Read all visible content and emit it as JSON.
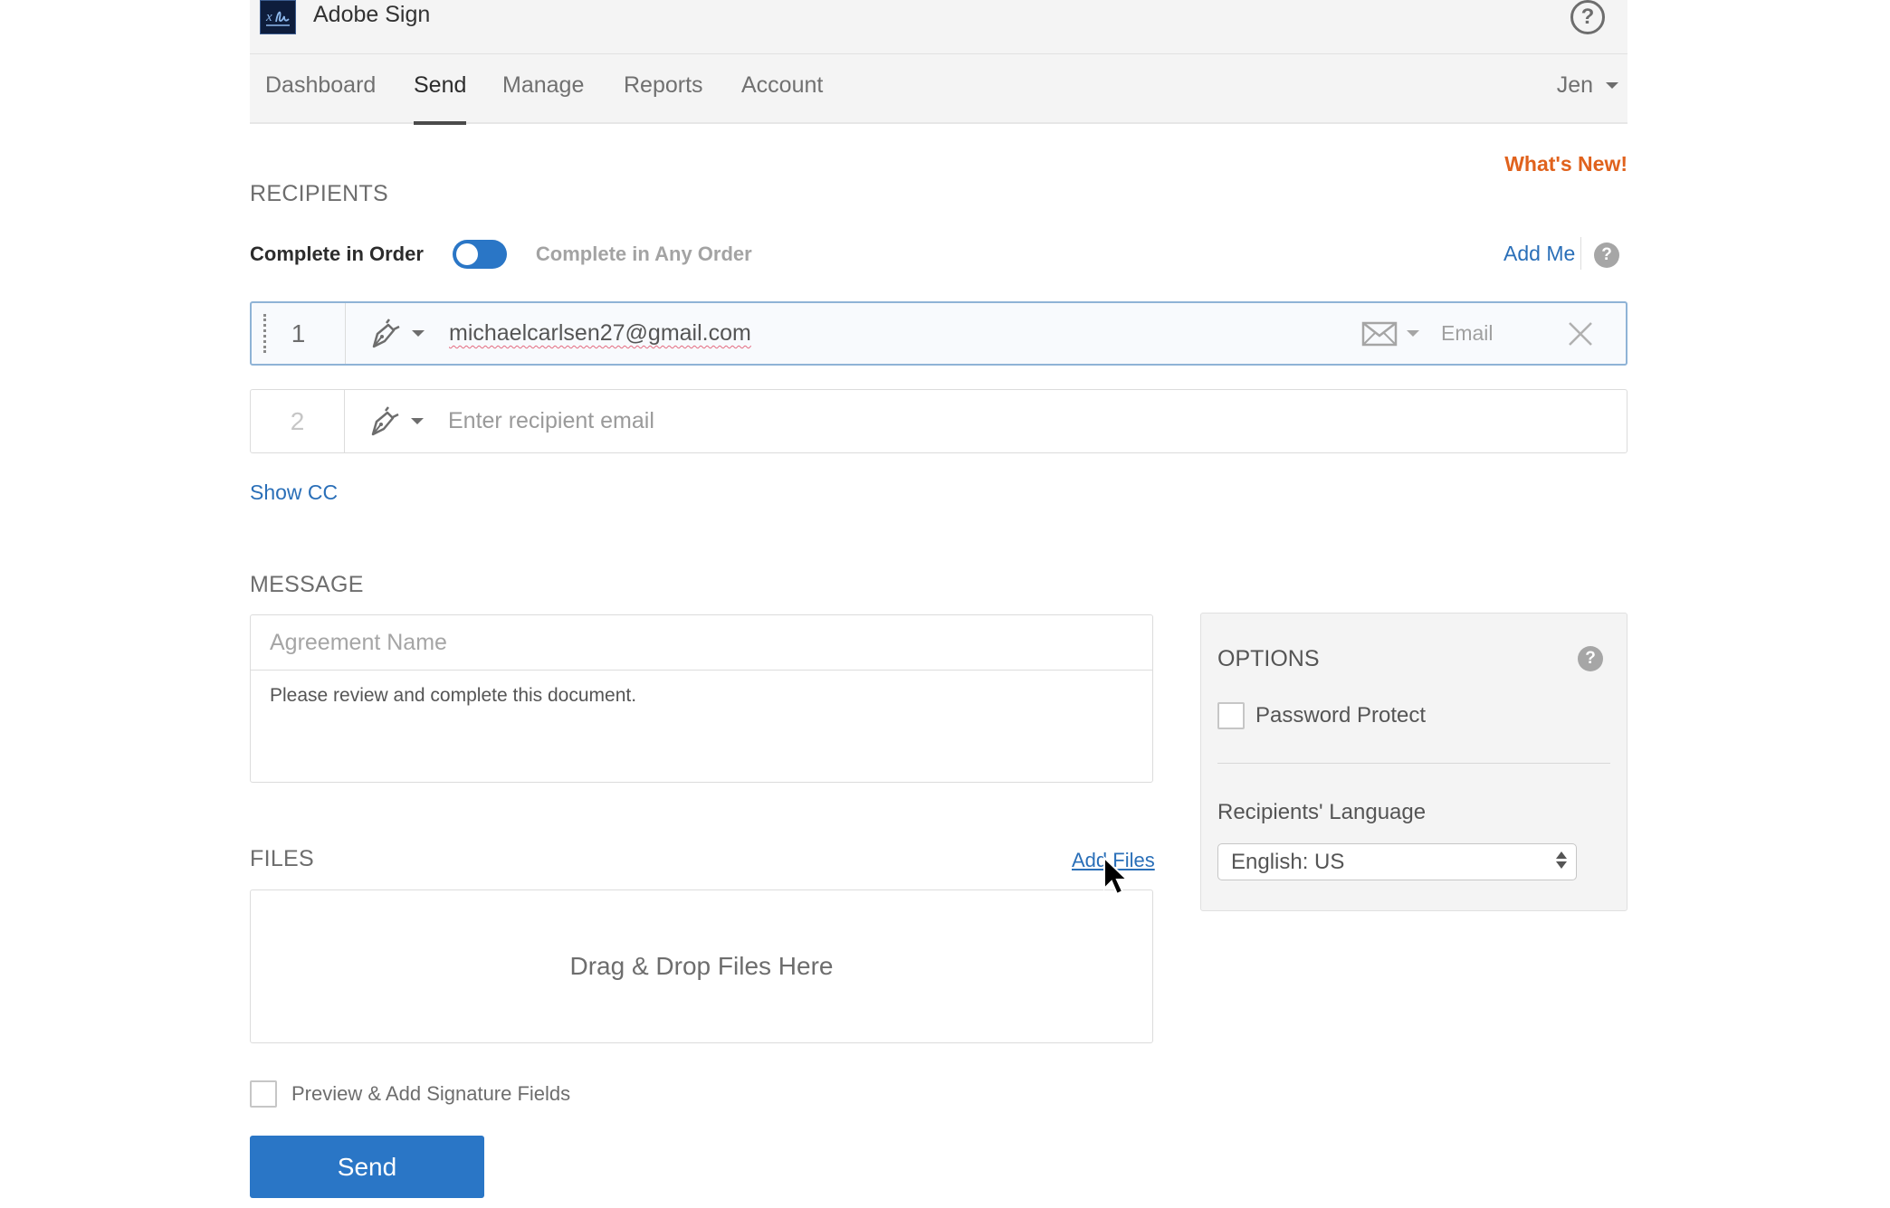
{
  "app": {
    "title": "Adobe Sign",
    "logo_icon": "adobe-sign-logo",
    "help_icon": "help-circle-icon"
  },
  "nav": {
    "items": [
      {
        "label": "Dashboard",
        "active": false
      },
      {
        "label": "Send",
        "active": true
      },
      {
        "label": "Manage",
        "active": false
      },
      {
        "label": "Reports",
        "active": false
      },
      {
        "label": "Account",
        "active": false
      }
    ],
    "user": "Jen"
  },
  "whats_new": "What's New!",
  "recipients": {
    "title": "RECIPIENTS",
    "order_label": "Complete in Order",
    "any_order_label": "Complete in Any Order",
    "order_toggle_state": "Complete in Order",
    "add_me": "Add Me",
    "rows": [
      {
        "number": "1",
        "role_icon": "pen-nib-icon",
        "email": "michaelcarlsen27@gmail.com",
        "auth_icon": "envelope-icon",
        "auth_label": "Email"
      },
      {
        "number": "2",
        "role_icon": "pen-nib-icon",
        "placeholder": "Enter recipient email"
      }
    ],
    "show_cc": "Show CC"
  },
  "message": {
    "title": "MESSAGE",
    "agreement_name_placeholder": "Agreement Name",
    "body": "Please review and complete this document."
  },
  "options": {
    "title": "OPTIONS",
    "password_protect": "Password Protect",
    "password_protect_checked": false,
    "language_label": "Recipients' Language",
    "language_value": "English: US"
  },
  "files": {
    "title": "FILES",
    "add_files": "Add Files",
    "dropzone": "Drag & Drop Files Here"
  },
  "preview": {
    "label": "Preview & Add Signature Fields",
    "checked": false
  },
  "send_button": "Send",
  "colors": {
    "accent": "#2a76c6",
    "link": "#2a6fb8",
    "whats_new": "#e0621d",
    "logo_bg": "#0e1d3c"
  }
}
